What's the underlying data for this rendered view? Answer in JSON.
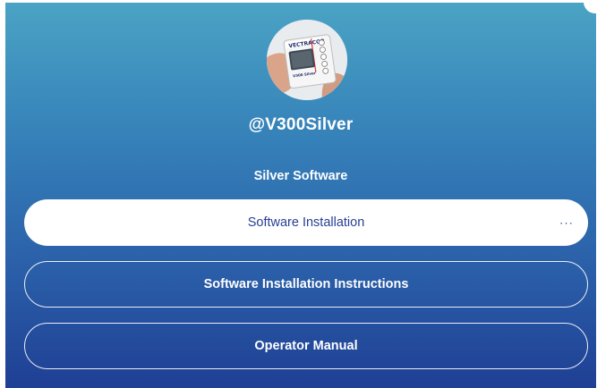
{
  "profile": {
    "username": "@V300Silver",
    "avatar_icon": "device-photo-avatar",
    "avatar_brand_text": "VECTRACOR",
    "avatar_model_text": "V300 Silver"
  },
  "section": {
    "title": "Silver Software"
  },
  "links": [
    {
      "label": "Software Installation",
      "style": "filled",
      "more_icon": "more-dots-icon",
      "more_glyph": "···"
    },
    {
      "label": "Software Installation Instructions",
      "style": "outline"
    },
    {
      "label": "Operator Manual",
      "style": "outline"
    }
  ],
  "colors": {
    "gradient_top": "#4aa3c4",
    "gradient_bottom": "#1f3f94",
    "primary_text": "#263f94",
    "white": "#ffffff"
  }
}
